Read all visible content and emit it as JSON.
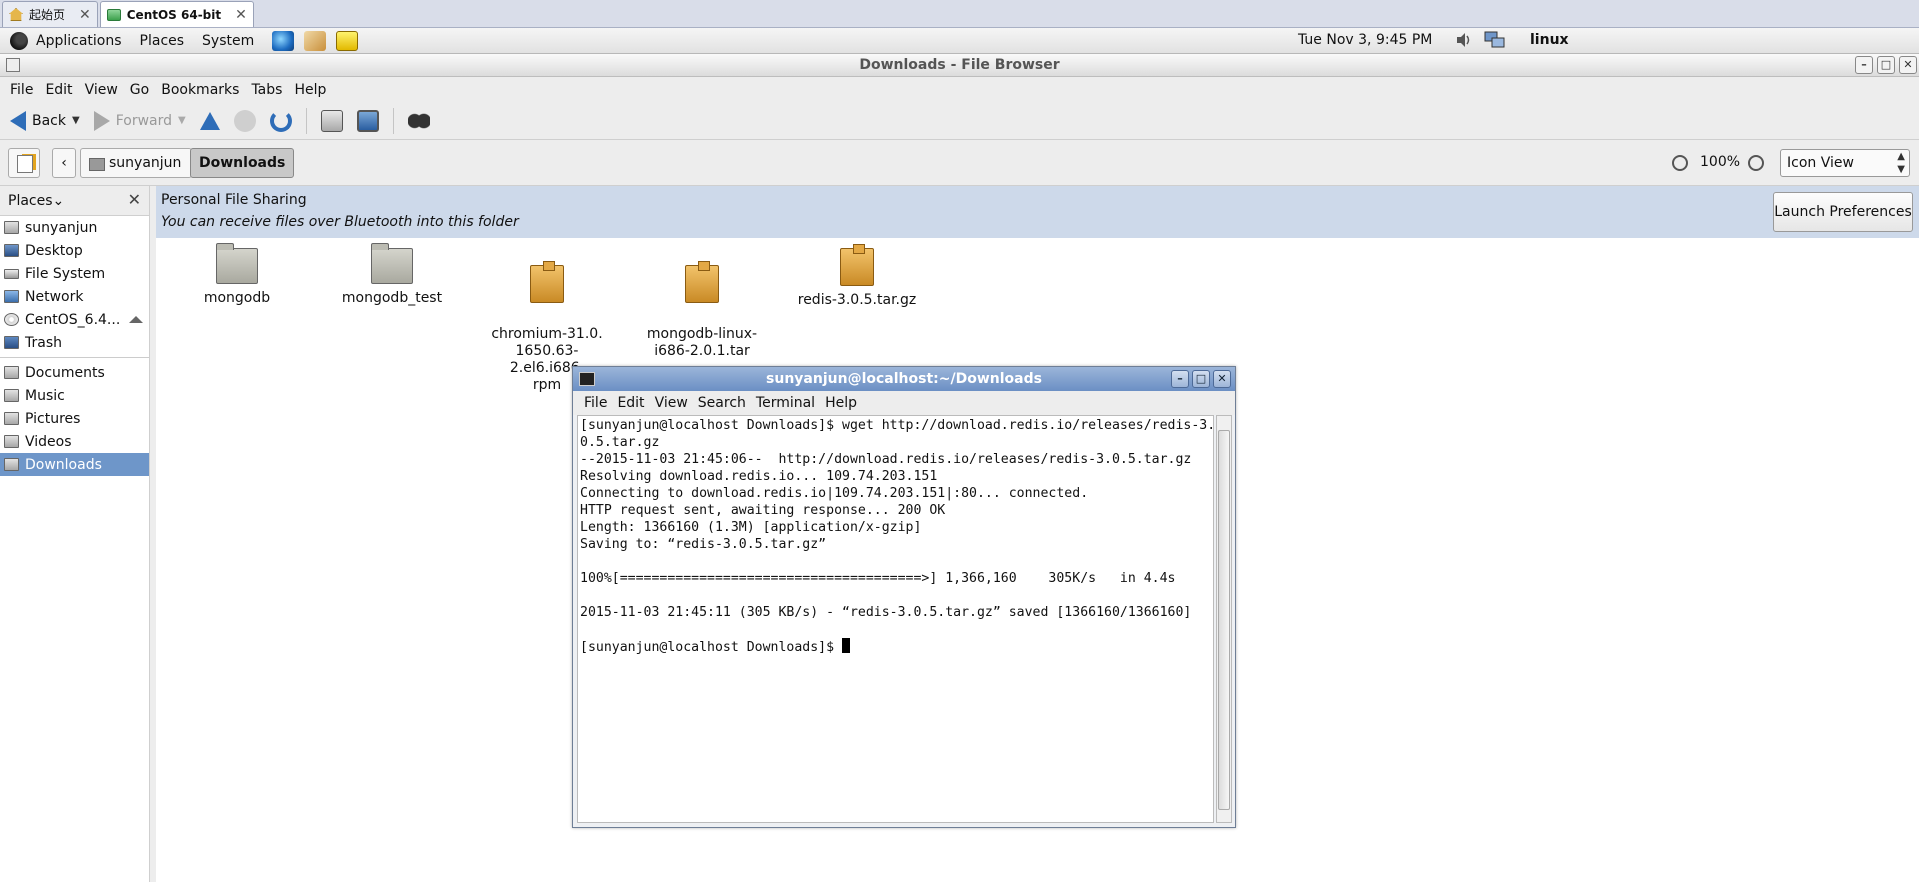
{
  "host_tabs": [
    {
      "label": "起始页",
      "close": "✕"
    },
    {
      "label": "CentOS 64-bit",
      "close": "✕"
    }
  ],
  "panel": {
    "menus": [
      "Applications",
      "Places",
      "System"
    ],
    "clock": "Tue Nov  3,  9:45 PM",
    "user": "linux"
  },
  "window": {
    "title": "Downloads - File Browser",
    "buttons": [
      "–",
      "□",
      "✕"
    ]
  },
  "menubar": [
    "File",
    "Edit",
    "View",
    "Go",
    "Bookmarks",
    "Tabs",
    "Help"
  ],
  "toolbar": {
    "back": "Back",
    "forward": "Forward"
  },
  "location": {
    "home": "sunyanjun",
    "current": "Downloads",
    "zoom": "100%",
    "view_mode": "Icon View"
  },
  "sidebar": {
    "header": "Places",
    "items": [
      {
        "label": "sunyanjun"
      },
      {
        "label": "Desktop"
      },
      {
        "label": "File System"
      },
      {
        "label": "Network"
      },
      {
        "label": "CentOS_6.4..."
      },
      {
        "label": "Trash"
      }
    ],
    "bookmarks": [
      {
        "label": "Documents"
      },
      {
        "label": "Music"
      },
      {
        "label": "Pictures"
      },
      {
        "label": "Videos"
      },
      {
        "label": "Downloads",
        "selected": true
      }
    ]
  },
  "infobar": {
    "title": "Personal File Sharing",
    "description": "You can receive files over Bluetooth into this folder",
    "button": "Launch Preferences"
  },
  "files": [
    {
      "name": "mongodb",
      "type": "folder"
    },
    {
      "name": "mongodb_test",
      "type": "folder"
    },
    {
      "name": "chromium-31.0.\n1650.63-2.el6.i686.\nrpm",
      "type": "package"
    },
    {
      "name": "mongodb-linux-\ni686-2.0.1.tar",
      "type": "package"
    },
    {
      "name": "redis-3.0.5.tar.gz",
      "type": "package"
    }
  ],
  "terminal": {
    "title": "sunyanjun@localhost:~/Downloads",
    "menus": [
      "File",
      "Edit",
      "View",
      "Search",
      "Terminal",
      "Help"
    ],
    "lines": [
      "[sunyanjun@localhost Downloads]$ wget http://download.redis.io/releases/redis-3.",
      "0.5.tar.gz",
      "--2015-11-03 21:45:06--  http://download.redis.io/releases/redis-3.0.5.tar.gz",
      "Resolving download.redis.io... 109.74.203.151",
      "Connecting to download.redis.io|109.74.203.151|:80... connected.",
      "HTTP request sent, awaiting response... 200 OK",
      "Length: 1366160 (1.3M) [application/x-gzip]",
      "Saving to: “redis-3.0.5.tar.gz”",
      "",
      "100%[======================================>] 1,366,160    305K/s   in 4.4s",
      "",
      "2015-11-03 21:45:11 (305 KB/s) - “redis-3.0.5.tar.gz” saved [1366160/1366160]",
      "",
      "[sunyanjun@localhost Downloads]$ "
    ]
  }
}
